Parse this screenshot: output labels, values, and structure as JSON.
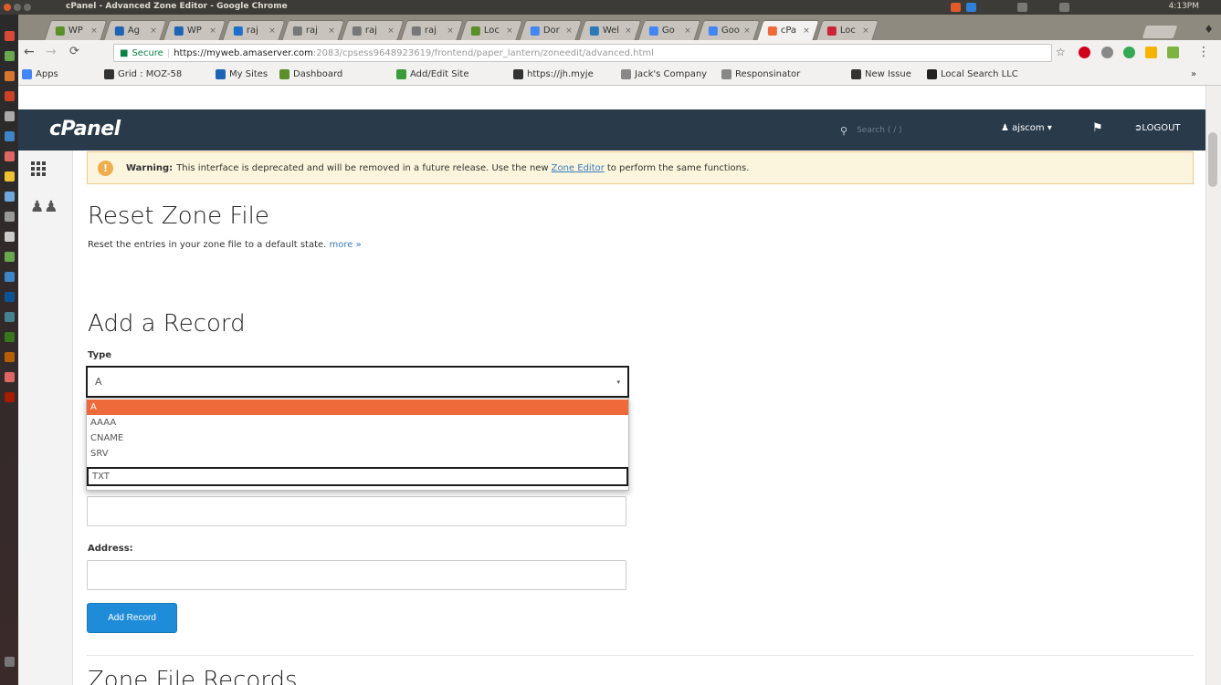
{
  "os": {
    "window_title": "cPanel - Advanced Zone Editor - Google Chrome",
    "clock": "4:13PM"
  },
  "browser": {
    "tabs": [
      {
        "label": "WP",
        "color": "#5a8f2a"
      },
      {
        "label": "Ag",
        "color": "#1e64b4"
      },
      {
        "label": "WP",
        "color": "#1e64b4"
      },
      {
        "label": "raj",
        "color": "#1d6fcc"
      },
      {
        "label": "raj",
        "color": "#777777"
      },
      {
        "label": "raj",
        "color": "#777777"
      },
      {
        "label": "raj",
        "color": "#777777"
      },
      {
        "label": "Loc",
        "color": "#5a8f2a"
      },
      {
        "label": "Dor",
        "color": "#4285f4"
      },
      {
        "label": "Wel",
        "color": "#2a7ab8"
      },
      {
        "label": "Go",
        "color": "#4285f4"
      },
      {
        "label": "Goo",
        "color": "#4285f4"
      },
      {
        "label": "cPa",
        "color": "#ef6a3a",
        "active": true
      },
      {
        "label": "Loc",
        "color": "#cc2233"
      }
    ],
    "secure_label": "Secure",
    "url_host": "https://myweb.amaserver.com",
    "url_path": ":2083/cpsess9648923619/frontend/paper_lantern/zoneedit/advanced.html",
    "bookmarks": [
      {
        "label": "Apps",
        "color": "#4285f4"
      },
      {
        "label": "Grid : MOZ-58",
        "color": "#333333"
      },
      {
        "label": "My Sites",
        "color": "#1e64b4"
      },
      {
        "label": "Dashboard",
        "color": "#5a8f2a"
      },
      {
        "label": "Add/Edit Site",
        "color": "#3a9b3a"
      },
      {
        "label": "https://jh.myje",
        "color": "#333333"
      },
      {
        "label": "Jack's Company",
        "color": "#888888"
      },
      {
        "label": "Responsinator",
        "color": "#888888"
      },
      {
        "label": "New Issue",
        "color": "#333333"
      },
      {
        "label": "Local Search LLC",
        "color": "#222222"
      }
    ],
    "bookmarks_more": "»"
  },
  "cpanel": {
    "logo": "cPanel",
    "search_placeholder": "Search ( / )",
    "user": "ajscom",
    "logout": "LOGOUT"
  },
  "warning": {
    "label": "Warning:",
    "text_before": "This interface is deprecated and will be removed in a future release. Use the new",
    "link": "Zone Editor",
    "text_after": "to perform the same functions."
  },
  "reset": {
    "title": "Reset Zone File",
    "description": "Reset the entries in your zone file to a default state.",
    "more": "more »"
  },
  "add_record": {
    "title": "Add a Record",
    "type_label": "Type",
    "type_value": "A",
    "type_options": [
      "A",
      "AAAA",
      "CNAME",
      "SRV",
      "TXT"
    ],
    "selected_option": "A",
    "hover_option": "TXT",
    "address_label": "Address:",
    "button": "Add Record"
  },
  "records": {
    "title": "Zone File Records"
  }
}
